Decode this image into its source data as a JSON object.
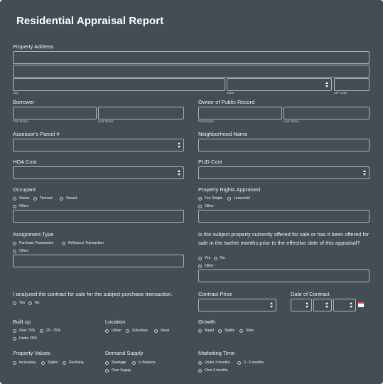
{
  "form": {
    "title": "Residential Appraisal Report",
    "property_address": {
      "label": "Property Address",
      "city": "City",
      "state": "State",
      "zip": "ZIP Code"
    },
    "borrower": {
      "label": "Borrower",
      "first": "First Name",
      "last": "Last Name"
    },
    "owner": {
      "label": "Owner of Public Record",
      "first": "First Name",
      "last": "Last Name"
    },
    "parcel": {
      "label": "Assessor's Parcel #"
    },
    "neighborhood": {
      "label": "Neighborhood Name"
    },
    "hoa": {
      "label": "HOA Cost"
    },
    "pud": {
      "label": "PUD Cost"
    },
    "occupant": {
      "label": "Occupant",
      "options": [
        "Owner",
        "Tennant",
        "Vacant"
      ],
      "other": "Other:"
    },
    "rights": {
      "label": "Property Rights Appraised",
      "options": [
        "Fee Simple",
        "Leasehold"
      ],
      "other": "Other:"
    },
    "assignment": {
      "label": "Assignment Type",
      "options": [
        "Purchase Transaction",
        "Refinance Transaction"
      ],
      "other": "Other:"
    },
    "offered": {
      "label": "Is the subject property currently offered for sale or has it been offered for sale in the twelve months prior to the effective date of this appraisal?",
      "options": [
        "Yes",
        "No"
      ],
      "other": "Other:"
    },
    "contract_analyzed": {
      "label": "I analyzed the contract for sale for the subject purchase transaction.",
      "options": [
        "Yes",
        "No"
      ]
    },
    "contract_price": {
      "label": "Contract Price"
    },
    "contract_date": {
      "label": "Date of Contract"
    },
    "built_up": {
      "label": "Built up",
      "options": [
        "Over 75%",
        "25 - 75%",
        "Under 25%"
      ]
    },
    "location": {
      "label": "Location",
      "options": [
        "Urban",
        "Suburban",
        "Rural"
      ]
    },
    "growth": {
      "label": "Growth",
      "options": [
        "Rapid",
        "Stable",
        "Slow"
      ]
    },
    "values": {
      "label": "Property Values",
      "options": [
        "Increasing",
        "Stable",
        "Declining"
      ]
    },
    "demand": {
      "label": "Demand Supply",
      "options": [
        "Shortage",
        "In Balance",
        "Over Supply"
      ]
    },
    "marketing": {
      "label": "Marketing Time",
      "options": [
        "Under 3 months",
        "3 - 6 months",
        "Over 6 months"
      ]
    }
  }
}
